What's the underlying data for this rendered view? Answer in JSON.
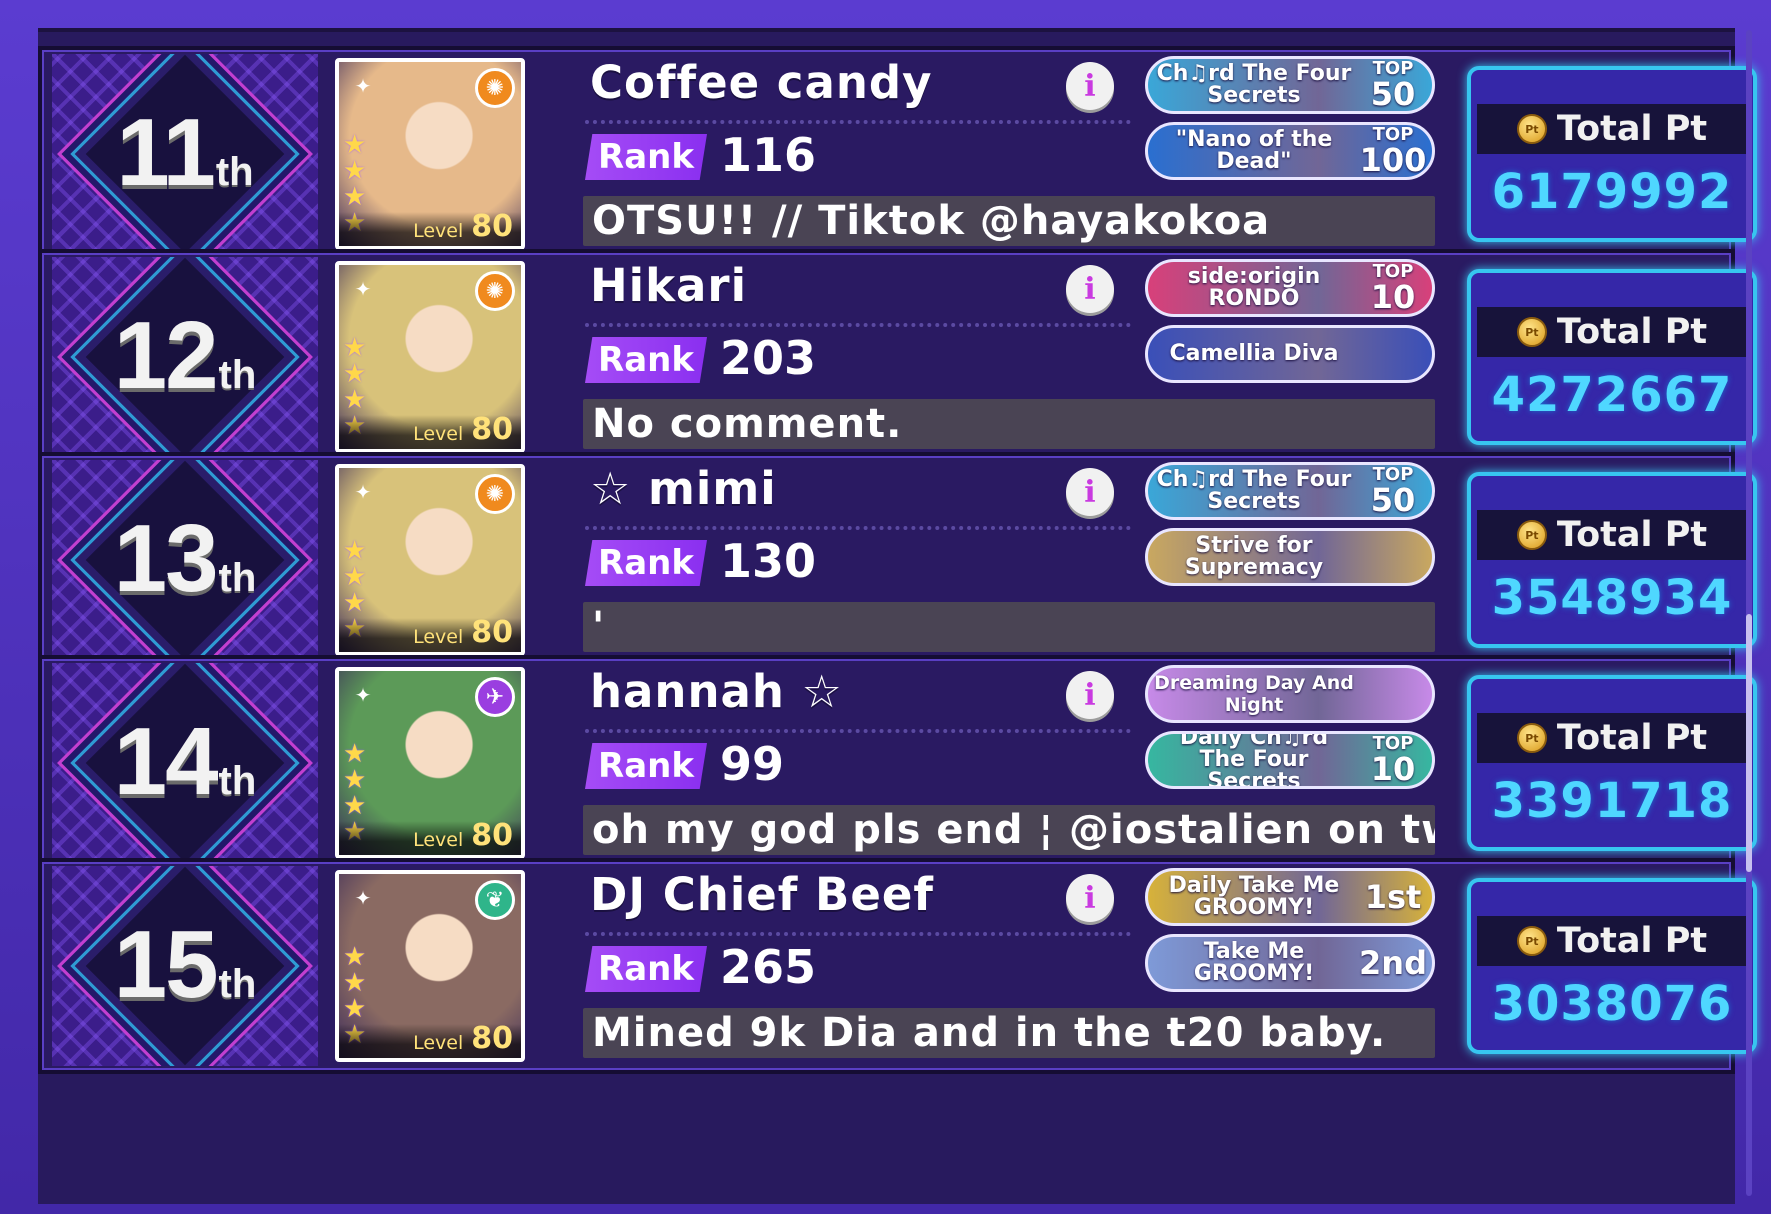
{
  "rows": [
    {
      "rank_num": "11",
      "rank_suffix": "th",
      "name": "Coffee candy",
      "rank_label": "Rank",
      "rank_value": "116",
      "comment": "OTSU!! // Tiktok @hayakokoa",
      "level_label": "Level",
      "level": "80",
      "badges": [
        {
          "text": "Ch♫rd The Four Secrets",
          "tier_top": "TOP",
          "tier_value": "50"
        },
        {
          "text": "\"Nano of the Dead\"",
          "tier_top": "TOP",
          "tier_value": "100"
        }
      ],
      "total_label": "Total Pt",
      "total_value": "6179992"
    },
    {
      "rank_num": "12",
      "rank_suffix": "th",
      "name": "Hikari",
      "rank_label": "Rank",
      "rank_value": "203",
      "comment": "No comment.",
      "level_label": "Level",
      "level": "80",
      "badges": [
        {
          "text": "side:origin RONDO",
          "tier_top": "TOP",
          "tier_value": "10"
        },
        {
          "text": "Camellia Diva",
          "tier_top": "",
          "tier_value": ""
        }
      ],
      "total_label": "Total Pt",
      "total_value": "4272667"
    },
    {
      "rank_num": "13",
      "rank_suffix": "th",
      "name": "☆ mimi",
      "rank_label": "Rank",
      "rank_value": "130",
      "comment": "'",
      "level_label": "Level",
      "level": "80",
      "badges": [
        {
          "text": "Ch♫rd The Four Secrets",
          "tier_top": "TOP",
          "tier_value": "50"
        },
        {
          "text": "Strive for Supremacy",
          "tier_top": "",
          "tier_value": ""
        }
      ],
      "total_label": "Total Pt",
      "total_value": "3548934"
    },
    {
      "rank_num": "14",
      "rank_suffix": "th",
      "name": "hannah ☆",
      "rank_label": "Rank",
      "rank_value": "99",
      "comment": "oh my god pls end ¦ @iostalien on twt",
      "level_label": "Level",
      "level": "80",
      "badges": [
        {
          "text": "Dreaming Day And Night",
          "tier_top": "",
          "tier_value": ""
        },
        {
          "text": "Daily Ch♫rd The Four Secrets",
          "tier_top": "TOP",
          "tier_value": "10"
        }
      ],
      "total_label": "Total Pt",
      "total_value": "3391718"
    },
    {
      "rank_num": "15",
      "rank_suffix": "th",
      "name": "DJ Chief Beef",
      "rank_label": "Rank",
      "rank_value": "265",
      "comment": "Mined 9k Dia and in the t20 baby.",
      "level_label": "Level",
      "level": "80",
      "badges": [
        {
          "text": "Daily Take Me GROOMY!",
          "tier_top": "",
          "tier_value": "1st"
        },
        {
          "text": "Take Me GROOMY!",
          "tier_top": "",
          "tier_value": "2nd"
        }
      ],
      "total_label": "Total Pt",
      "total_value": "3038076"
    }
  ],
  "coin_text": "Pt",
  "info_glyph": "i",
  "colors": {
    "badge_0_0": "#3aa7d8",
    "badge_0_1": "#2a6fd0",
    "badge_1_0": "#d8407a",
    "badge_1_1": "#3a4fb8",
    "badge_2_0": "#3aa7d8",
    "badge_2_1": "#c9a860",
    "badge_3_0": "#c78ae8",
    "badge_3_1": "#36b7a0",
    "badge_4_0": "#d7b23a",
    "badge_4_1": "#7e9ad8",
    "attr_0": "#f08a1e",
    "attr_1": "#f08a1e",
    "attr_2": "#f08a1e",
    "attr_3": "#9a3ee0",
    "attr_4": "#2fb58a",
    "art_0": "#e6b98a",
    "art_1": "#d8c27a",
    "art_2": "#d8c27a",
    "art_3": "#5c9a58",
    "art_4": "#8a6a62"
  }
}
